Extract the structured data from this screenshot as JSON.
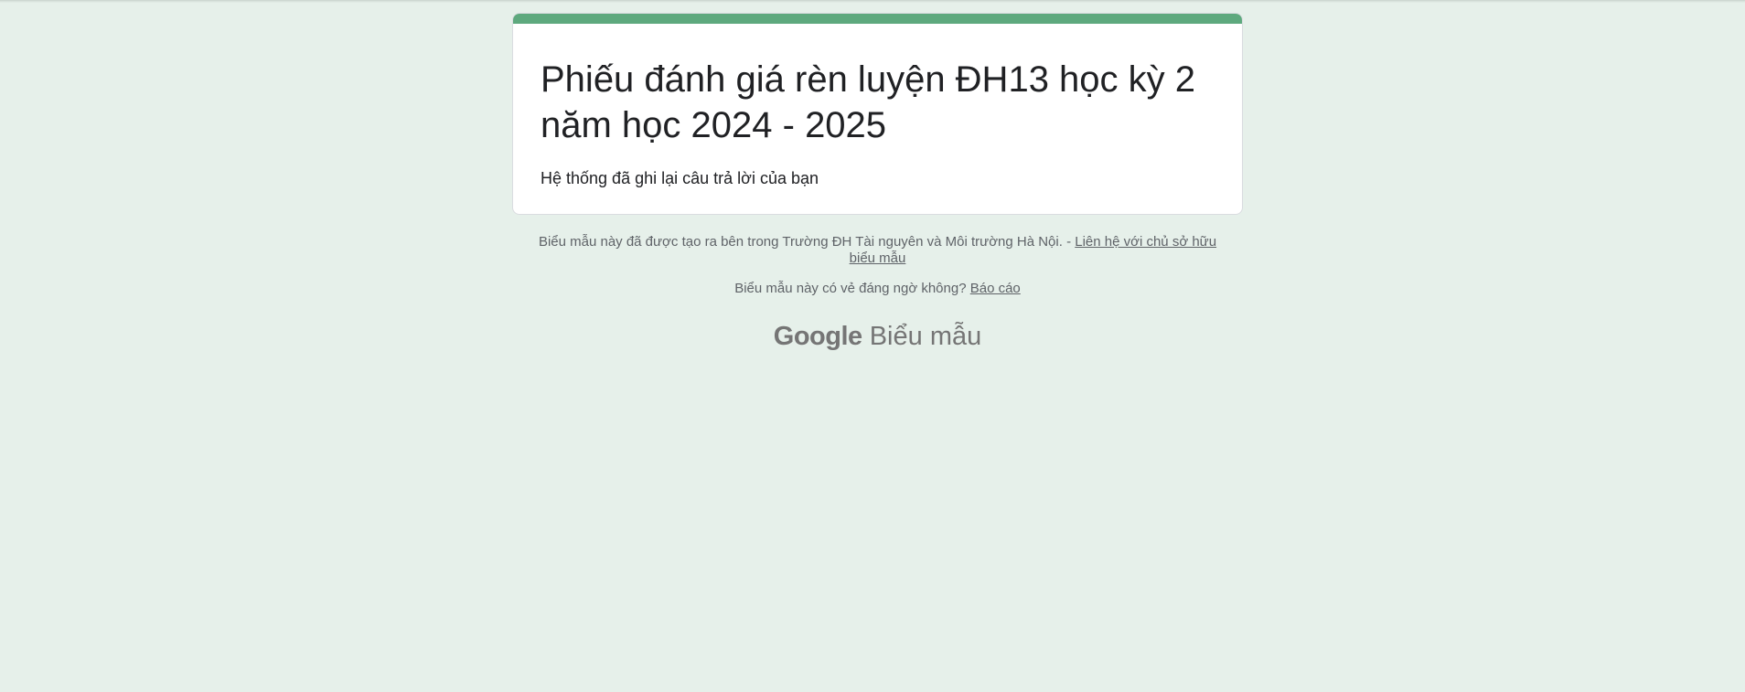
{
  "form": {
    "title": "Phiếu đánh giá rèn luyện ĐH13 học kỳ 2 năm học 2024 - 2025",
    "confirmation": "Hệ thống đã ghi lại câu trả lời của bạn"
  },
  "footer": {
    "created_text": "Biểu mẫu này đã được tạo ra bên trong Trường ĐH Tài nguyên và Môi trường Hà Nội. -",
    "contact_link": "Liên hệ với chủ sở hữu biểu mẫu",
    "report_question": "Biểu mẫu này có vẻ đáng ngờ không?",
    "report_link": "Báo cáo"
  },
  "brand": {
    "google": "Google",
    "product": "Biểu mẫu"
  },
  "colors": {
    "background": "#e6f0ea",
    "accent": "#5ea97e",
    "card": "#ffffff",
    "text": "#202124",
    "muted": "#5f6368"
  }
}
